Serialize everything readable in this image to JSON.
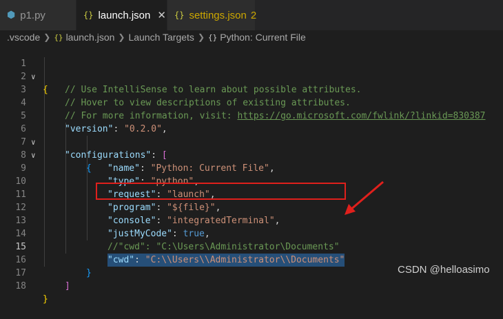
{
  "tabs": [
    {
      "icon": "python-file-icon",
      "glyph": "⬢",
      "label": "p1.py",
      "active": false
    },
    {
      "icon": "json-braces-icon",
      "glyph": "{}",
      "label": "launch.json",
      "active": true
    },
    {
      "icon": "json-braces-icon",
      "glyph": "{}",
      "label": "settings.json",
      "badge": "2",
      "active": false
    }
  ],
  "breadcrumb": {
    "items": [
      ".vscode",
      "launch.json",
      "Launch Targets",
      "Python: Current File"
    ],
    "glyph": "{}"
  },
  "colors": {
    "selection": "#264f78",
    "annotation": "#e0201c",
    "bg": "#1e1e1e"
  },
  "lines": {
    "n1": "1",
    "n2": "2",
    "n3": "3",
    "n4": "4",
    "n5": "5",
    "n6": "6",
    "n7": "7",
    "n8": "8",
    "n9": "9",
    "n10": "10",
    "n11": "11",
    "n12": "12",
    "n13": "13",
    "n14": "14",
    "n15": "15",
    "n16": "16",
    "n17": "17",
    "n18": "18",
    "l2": "// Use IntelliSense to learn about possible attributes.",
    "l3": "// Hover to view descriptions of existing attributes.",
    "l4_pre": "// For more information, visit: ",
    "l4_link": "https://go.microsoft.com/fwlink/?linkid=830387",
    "version_key": "\"version\"",
    "version_val": "\"0.2.0\"",
    "configs_key": "\"configurations\"",
    "name_key": "\"name\"",
    "name_val": "\"Python: Current File\"",
    "type_key": "\"type\"",
    "type_val": "\"python\"",
    "request_key": "\"request\"",
    "request_val": "\"launch\"",
    "program_key": "\"program\"",
    "program_val": "\"${file}\"",
    "console_key": "\"console\"",
    "console_val": "\"integratedTerminal\"",
    "jmc_key": "\"justMyCode\"",
    "jmc_val": "true",
    "l14": "//\"cwd\": \"C:\\Users\\Administrator\\Documents\"",
    "cwd_key": "\"cwd\"",
    "cwd_val": "\"C:\\\\Users\\\\Administrator\\\\Documents\""
  },
  "watermark": "CSDN @helloasimo"
}
